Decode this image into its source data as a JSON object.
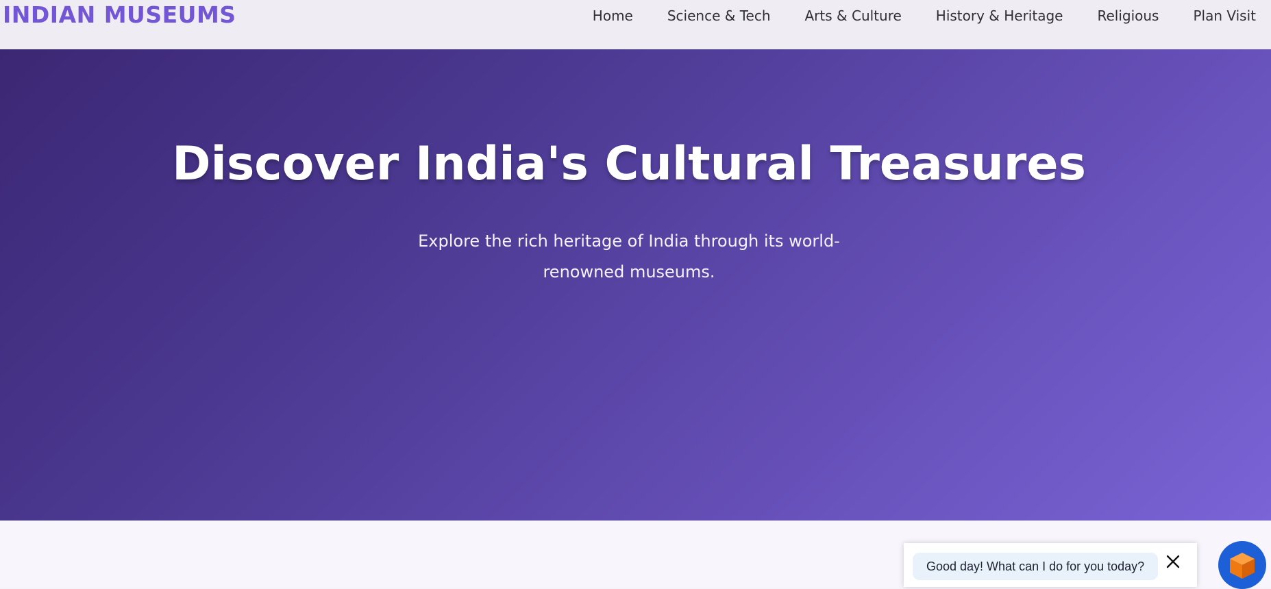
{
  "header": {
    "logo": "INDIAN MUSEUMS",
    "nav": [
      {
        "label": "Home"
      },
      {
        "label": "Science & Tech"
      },
      {
        "label": "Arts & Culture"
      },
      {
        "label": "History & Heritage"
      },
      {
        "label": "Religious"
      },
      {
        "label": "Plan Visit"
      }
    ]
  },
  "hero": {
    "title": "Discover India's Cultural Treasures",
    "subtitle": "Explore the rich heritage of India through its world-renowned museums."
  },
  "chat": {
    "greeting": "Good day! What can I do for you today?",
    "close_icon": "close-icon",
    "launcher_icon": "cube-icon"
  },
  "colors": {
    "brand": "#7356d6",
    "hero_start": "#3c2774",
    "hero_end": "#7a64d6",
    "launcher": "#1d5fd6",
    "cube": "#f07a12"
  }
}
